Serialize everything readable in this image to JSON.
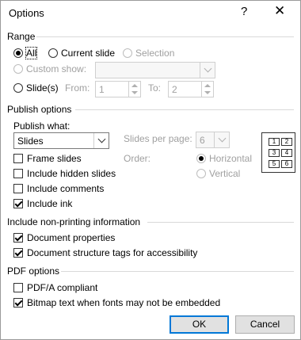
{
  "dialog": {
    "title": "Options",
    "help": "?",
    "close": "✕"
  },
  "range": {
    "title": "Range",
    "all": "All",
    "current_slide": "Current slide",
    "selection": "Selection",
    "custom_show": "Custom show:",
    "slides": "Slide(s)",
    "from_label": "From:",
    "from_value": "1",
    "to_label": "To:",
    "to_value": "2"
  },
  "publish": {
    "title": "Publish options",
    "publish_what_label": "Publish what:",
    "publish_what_value": "Slides",
    "slides_per_page_label": "Slides per page:",
    "slides_per_page_value": "6",
    "order_label": "Order:",
    "horizontal": "Horizontal",
    "vertical": "Vertical",
    "frame_slides": "Frame slides",
    "include_hidden": "Include hidden slides",
    "include_comments": "Include comments",
    "include_ink": "Include ink",
    "layout_numbers": [
      "1",
      "2",
      "3",
      "4",
      "5",
      "6"
    ]
  },
  "nonprinting": {
    "title": "Include non-printing information",
    "doc_properties": "Document properties",
    "doc_structure": "Document structure tags for accessibility"
  },
  "pdf": {
    "title": "PDF options",
    "pdfa": "PDF/A compliant",
    "bitmap": "Bitmap text when fonts may not be embedded"
  },
  "buttons": {
    "ok": "OK",
    "cancel": "Cancel"
  }
}
